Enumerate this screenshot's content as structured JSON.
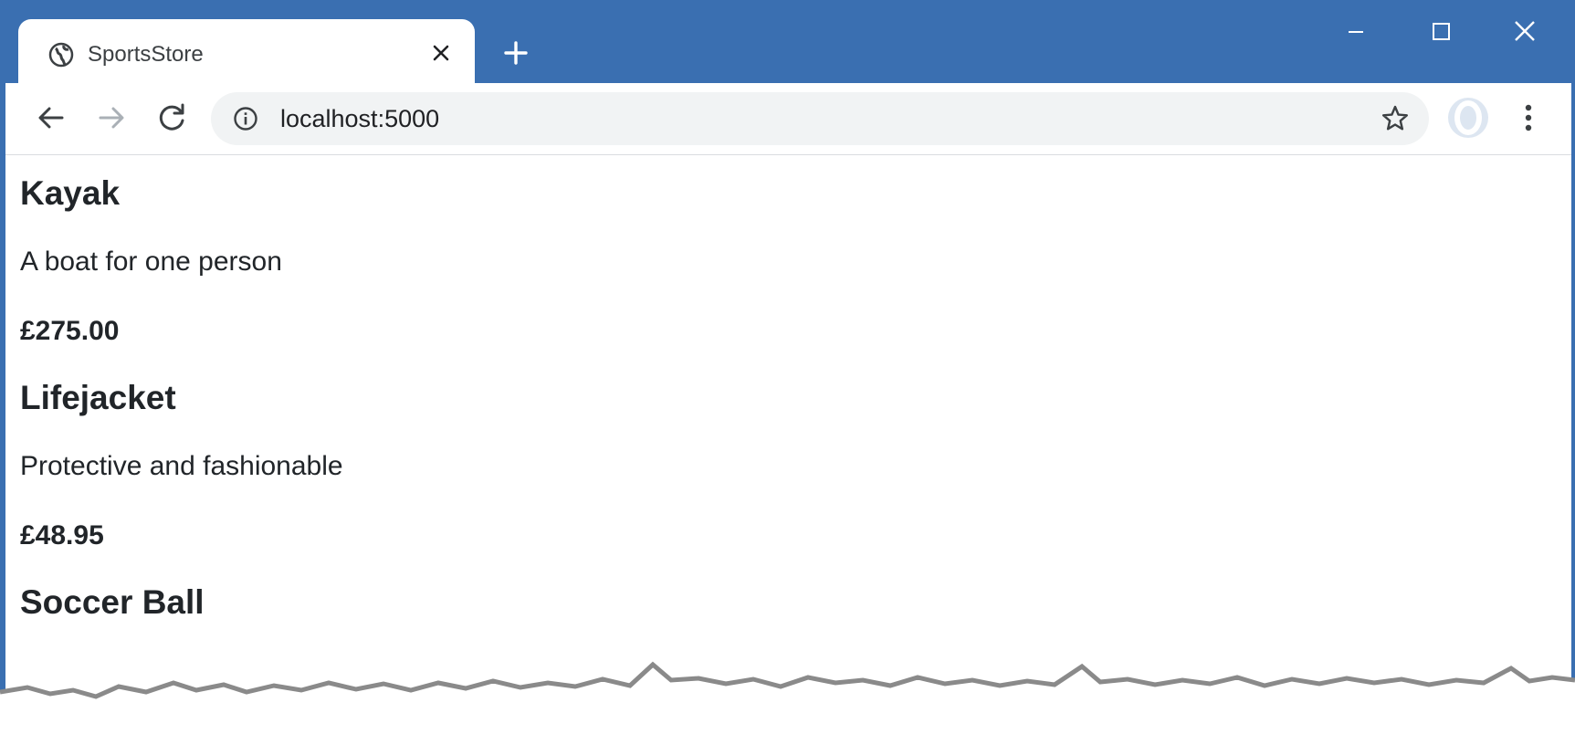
{
  "browser": {
    "tab_title": "SportsStore",
    "url": "localhost:5000"
  },
  "products": [
    {
      "name": "Kayak",
      "description": "A boat for one person",
      "price": "£275.00"
    },
    {
      "name": "Lifejacket",
      "description": "Protective and fashionable",
      "price": "£48.95"
    },
    {
      "name": "Soccer Ball"
    }
  ],
  "colors": {
    "titlebar": "#3a6fb1",
    "omnibox": "#f1f3f4",
    "text": "#212529"
  },
  "icons": {
    "tab": "globe-icon",
    "close_tab": "close-icon",
    "new_tab": "plus-icon",
    "back": "arrow-left-icon",
    "forward": "arrow-right-icon",
    "reload": "reload-icon",
    "site_info": "info-icon",
    "bookmark": "star-icon",
    "profile": "avatar-icon",
    "menu": "kebab-menu-icon"
  }
}
